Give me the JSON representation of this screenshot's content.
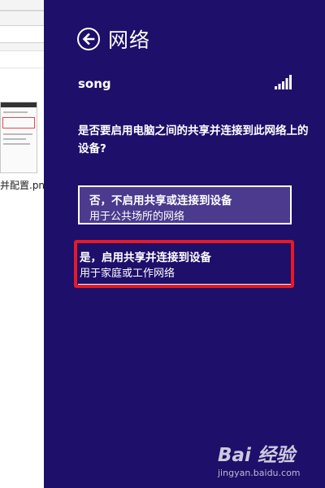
{
  "background_window": {
    "file_label": "并配置.png"
  },
  "flyout": {
    "title": "网络",
    "network_name": "song",
    "question": "是否要启用电脑之间的共享并连接到此网络上的设备?",
    "options": [
      {
        "title": "否，不启用共享或连接到设备",
        "subtitle": "用于公共场所的网络"
      },
      {
        "title": "是，启用共享并连接到设备",
        "subtitle": "用于家庭或工作网络"
      }
    ]
  },
  "watermark": {
    "logo_text": "Bai 经验",
    "url": "jingyan.baidu.com"
  },
  "colors": {
    "flyout_background": "#1e0f6a",
    "selected_option": "#4b3a8e",
    "highlight": "#e51a24"
  },
  "icons": [
    "back-arrow-icon",
    "wifi-signal-icon",
    "baidu-paw-icon"
  ]
}
